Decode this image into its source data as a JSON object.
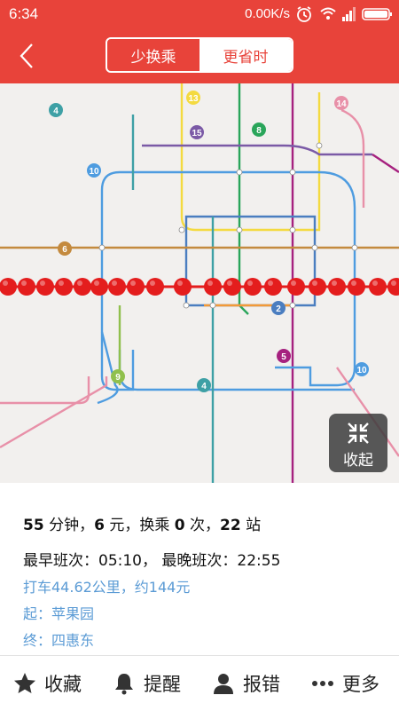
{
  "status_bar": {
    "time": "6:34",
    "network_speed": "0.00K/s",
    "icons": [
      "alarm-icon",
      "wifi-icon",
      "signal-icon",
      "battery-icon"
    ]
  },
  "header": {
    "back_icon": "chevron-left-icon",
    "tabs": [
      {
        "label": "少换乘",
        "selected": false
      },
      {
        "label": "更省时",
        "selected": true
      }
    ]
  },
  "map": {
    "line_numbers": [
      "13",
      "4",
      "14",
      "15",
      "8",
      "10",
      "6",
      "2",
      "5",
      "9",
      "4",
      "10"
    ],
    "collapse_label": "收起"
  },
  "route": {
    "duration": "55",
    "duration_unit": "分钟",
    "fare": "6",
    "fare_unit": "元",
    "transfers_label": "换乘",
    "transfers": "0",
    "transfers_unit": "次",
    "stops": "22",
    "stops_unit": "站",
    "earliest_label": "最早班次：",
    "earliest": "05:10",
    "latest_label": "最晚班次：",
    "latest": "22:55",
    "taxi": "打车44.62公里，约144元",
    "from": "起：苹果园",
    "to": "终：四惠东"
  },
  "toolbar": [
    {
      "label": "收藏",
      "icon": "star-icon"
    },
    {
      "label": "提醒",
      "icon": "bell-icon"
    },
    {
      "label": "报错",
      "icon": "user-icon"
    },
    {
      "label": "更多",
      "icon": "more-icon"
    }
  ],
  "colors": {
    "accent": "#e8433a",
    "info_text": "#5b9bd5"
  }
}
